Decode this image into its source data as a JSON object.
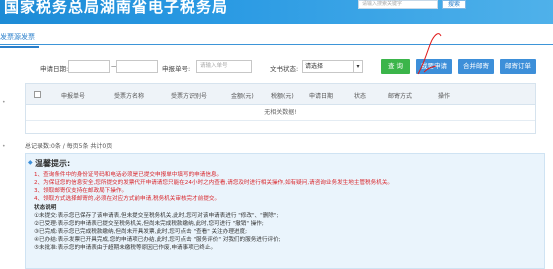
{
  "header": {
    "title": "国家税务总局湖南省电子税务局",
    "search_placeholder": "请输入搜索关键字",
    "search_button": "搜索"
  },
  "tabs": [
    "发票源发票"
  ],
  "filters": {
    "apply_date_label": "申请日期:",
    "apply_no_label": "申报单号:",
    "apply_no_placeholder": "请输入单号",
    "doc_status_label": "文书状态:",
    "doc_status_value": "请选择"
  },
  "buttons": {
    "query": "查 询",
    "apply": "我要申请",
    "merge_mail": "合并邮寄",
    "mail_order": "邮寄订单"
  },
  "table": {
    "columns": [
      "申报单号",
      "受票方名称",
      "受票方识别号",
      "金额(元)",
      "税额(元)",
      "申请日期",
      "状态",
      "邮寄方式",
      "操作"
    ],
    "empty_text": "无相关数据!"
  },
  "pager": "总记录数:0条 / 每页5条  共计0页",
  "notice": {
    "title": "温馨提示:",
    "red_lines": [
      "1、查询条件中的身份证号码和电话必须是已提交申报单中填写的申请信息。",
      "2、为保证您的信息安全,您所提交的发票代开申请请您只能在24小时之内查看,请您及时进行相关操作,如有疑问,请咨询业务发生地主管税务机关。",
      "3、领取邮寄仅支持在邮政局下操作。",
      "4、领取方式选择邮寄的,必须在对应方式前申请,税务机关审核完才前提交。"
    ],
    "status_title": "状态说明",
    "status_lines": [
      "①未提交:表示您已保存了该申请表,但未提交至税务机关,此时,您可对该申请表进行 \"修改\"、\"删除\";",
      "②已受理:表示您的申请表已提交至税务机关,但尚未完成税款缴纳,此时,您可进行 \"撤销\" 操作;",
      "③已完成:表示您已完成税款缴纳,但尚未开具发票,此时,您可点击 \"查看\" 关注办理进度;",
      "④已办结:表示发票已开具完成,您的申请项已办结,此时,您可点击 \"服务评价\" 对我们的服务进行评价;",
      "⑤未批准:表示您的申请表由于超期未缴税等原因已作废,申请事项已终止。"
    ]
  }
}
